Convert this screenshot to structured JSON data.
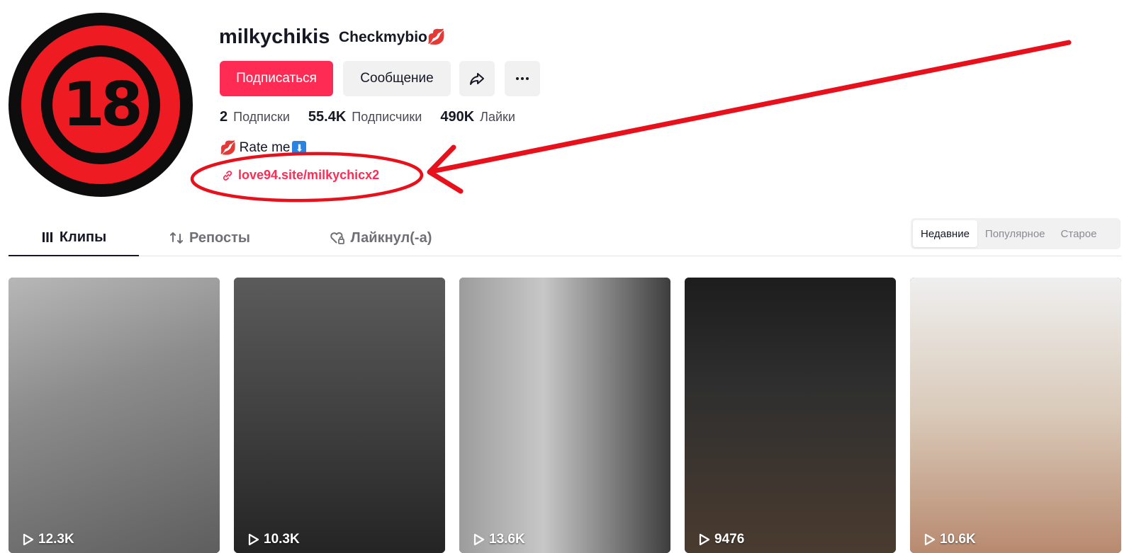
{
  "profile": {
    "avatar_text": "18",
    "username": "milkychikis",
    "nickname": "Checkmybio",
    "nickname_emoji": "💋",
    "follow_label": "Подписаться",
    "message_label": "Сообщение",
    "bio_emoji": "💋",
    "bio": "Rate me",
    "bio_arrow": "⬇",
    "link": "love94.site/milkychicx2"
  },
  "stats": [
    {
      "value": "2",
      "label": "Подписки"
    },
    {
      "value": "55.4K",
      "label": "Подписчики"
    },
    {
      "value": "490K",
      "label": "Лайки"
    }
  ],
  "tabs": [
    {
      "label": "Клипы",
      "active": true
    },
    {
      "label": "Репосты",
      "active": false
    },
    {
      "label": "Лайкнул(-а)",
      "active": false
    }
  ],
  "sort": [
    {
      "label": "Недавние",
      "active": true
    },
    {
      "label": "Популярное",
      "active": false
    },
    {
      "label": "Старое",
      "active": false
    }
  ],
  "videos": [
    {
      "views": "12.3K"
    },
    {
      "views": "10.3K"
    },
    {
      "views": "13.6K"
    },
    {
      "views": "9476"
    },
    {
      "views": "10.6K"
    }
  ],
  "colors": {
    "accent": "#fe2c55",
    "annotation": "#e8101a"
  }
}
